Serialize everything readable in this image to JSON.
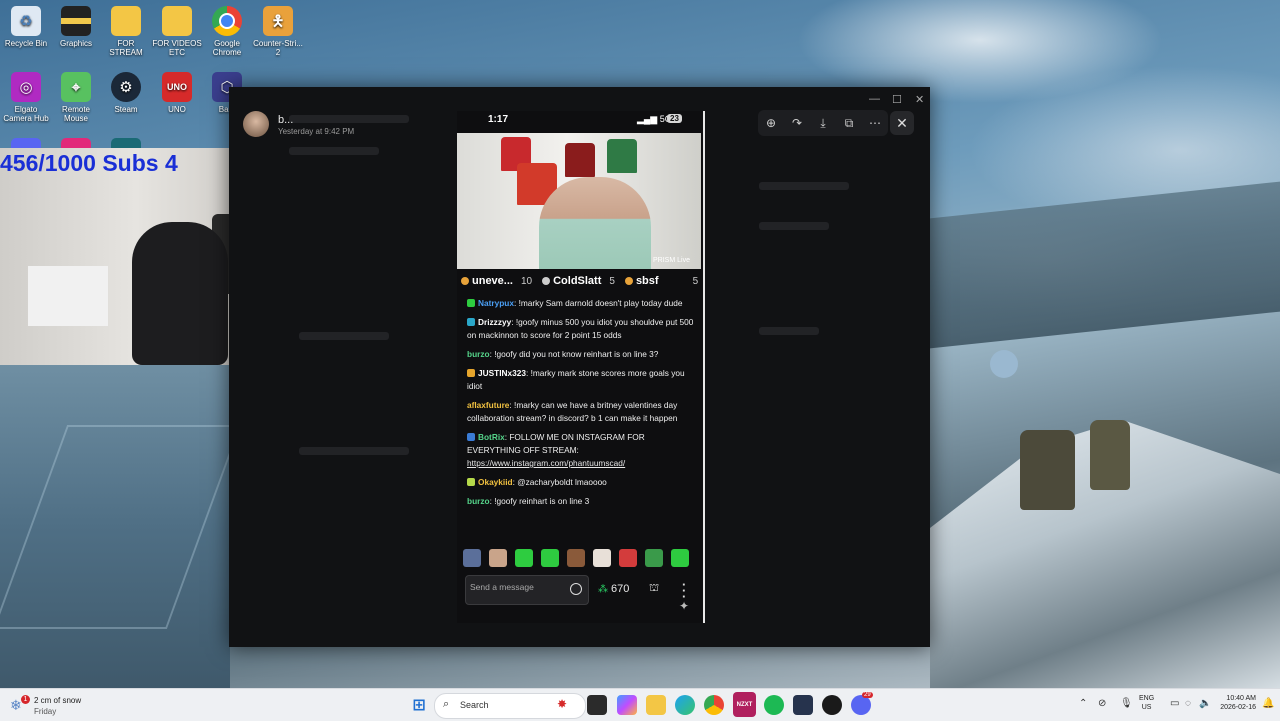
{
  "desktop": {
    "icons": [
      {
        "label": "Recycle Bin",
        "icon": "recycle-bin-icon"
      },
      {
        "label": "Graphics",
        "icon": "folder-icon"
      },
      {
        "label": "FOR STREAM",
        "icon": "folder-icon"
      },
      {
        "label": "FOR VIDEOS ETC",
        "icon": "folder-icon"
      },
      {
        "label": "Google Chrome",
        "icon": "chrome-icon"
      },
      {
        "label": "Counter-Stri... 2",
        "icon": "cs2-icon"
      },
      {
        "label": "Elgato Camera Hub",
        "icon": "elgato-icon"
      },
      {
        "label": "Remote Mouse",
        "icon": "remote-mouse-icon"
      },
      {
        "label": "Steam",
        "icon": "steam-icon"
      },
      {
        "label": "UNO",
        "icon": "uno-icon"
      },
      {
        "label": "Ba...",
        "icon": "app-icon"
      }
    ]
  },
  "webcam": {
    "subs_text": "456/1000 Subs  4"
  },
  "viewer": {
    "sender_name": "b...",
    "sent_time": "Yesterday at 9:42 PM",
    "toolbar": [
      "zoom-in-icon",
      "forward-icon",
      "download-icon",
      "open-external-icon",
      "more-icon"
    ],
    "close_icon": "close-icon"
  },
  "phone": {
    "status": {
      "time": "1:17",
      "signal": "5G",
      "battery": "23"
    },
    "prism_label": "PRISM",
    "prism_suffix": "Live",
    "gift_leaders": [
      {
        "name": "uneve...",
        "count": "10"
      },
      {
        "name": "ColdSlatt",
        "count": "5"
      },
      {
        "name": "sbsf",
        "count": "5"
      }
    ],
    "messages": [
      {
        "user": "Natrypux",
        "color": "#4a9ff5",
        "badge": "#2ecc40",
        "text": ": !marky Sam darnold doesn't play today dude"
      },
      {
        "user": "Drizzzyy",
        "color": "#ffffff",
        "badge": "#2aa7c9",
        "text": ": !goofy minus 500 you idiot you shouldve put 500 on mackinnon to score for 2 point 15 odds"
      },
      {
        "user": "burzo",
        "color": "#55d48a",
        "badge": "",
        "text": ": !goofy did you not know reinhart is on line 3?"
      },
      {
        "user": "JUSTINx323",
        "color": "#ffffff",
        "badge": "#e6a52c",
        "text": ": !marky mark stone scores more goals you idiot"
      },
      {
        "user": "aflaxfuture",
        "color": "#f0c040",
        "badge": "",
        "text": ": !marky can we have a britney valentines day collaboration stream? in discord? b 1 can make it happen"
      },
      {
        "user": "BotRix",
        "color": "#55d48a",
        "badge": "#3a7bd5",
        "text": ": FOLLOW ME ON INSTAGRAM FOR EVERYTHING OFF STREAM:",
        "link": "https://www.instagram.com/phantuumscad/"
      },
      {
        "user": "Okaykiid",
        "color": "#f0c040",
        "badge": "#b5d94a",
        "text": ": @zacharyboldt lmaoooo"
      },
      {
        "user": "burzo",
        "color": "#55d48a",
        "badge": "",
        "text": ": !goofy reinhart is on line 3"
      }
    ],
    "emotes": [
      "#5b6f9a",
      "#c9a48a",
      "#2ecc40",
      "#2ecc40",
      "#8a5a3a",
      "#e8e0d8",
      "#d33c3c",
      "#3a9a4a",
      "#2ecc40"
    ],
    "input_placeholder": "Send a message",
    "points": "670"
  },
  "taskbar": {
    "weather_main": "2 cm of snow",
    "weather_sub": "Friday",
    "weather_badge": "1",
    "search_label": "Search",
    "lang_top": "ENG",
    "lang_bottom": "US",
    "time": "10:40 AM",
    "date": "2026-02-16",
    "discord_badge": "29"
  }
}
